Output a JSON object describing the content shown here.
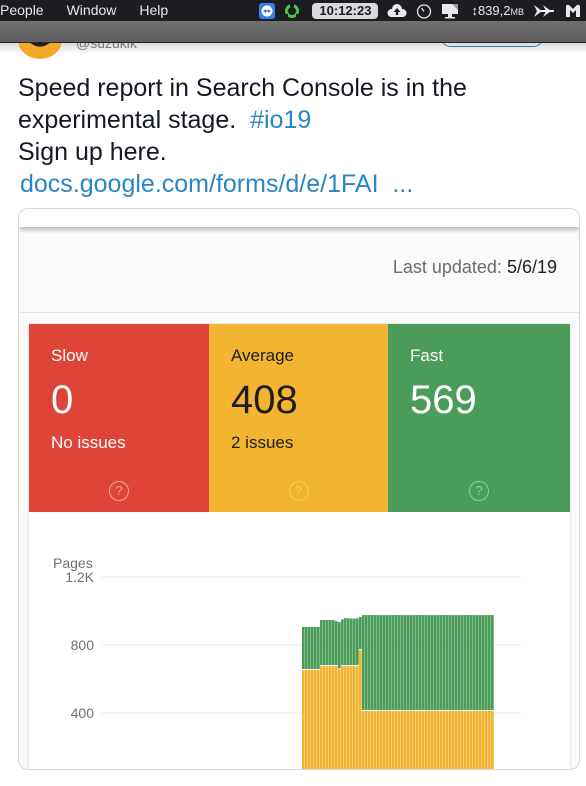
{
  "menubar": {
    "menus": [
      "People",
      "Window",
      "Help"
    ],
    "icons": [
      "teamviewer-icon",
      "sync-icon",
      "upload-cloud-icon",
      "timer-icon",
      "display-icon",
      "forward-icon",
      "malwarebytes-icon"
    ],
    "clock": "10:12:23",
    "memory": "839,2",
    "memory_unit": "MB"
  },
  "tweet": {
    "handle": "@suzukik",
    "text_line1": "Speed report in Search Console is in the",
    "text_line2": "experimental stage.",
    "hashtag": "#io19",
    "text_line3": "Sign up here.",
    "link": "docs.google.com/forms/d/e/1FAI",
    "link_ellipsis": "..."
  },
  "card": {
    "last_updated_label": "Last updated:",
    "last_updated_value": "5/6/19",
    "tiles": [
      {
        "label": "Slow",
        "value": "0",
        "sub": "No issues",
        "color": "#de4437"
      },
      {
        "label": "Average",
        "value": "408",
        "sub": "2 issues",
        "color": "#f3b432"
      },
      {
        "label": "Fast",
        "value": "569",
        "sub": "",
        "color": "#4b9c59"
      }
    ]
  },
  "chart_data": {
    "type": "bar",
    "stacked": true,
    "ylabel": "Pages",
    "yticks": [
      "1.2K",
      "800",
      "400"
    ],
    "ylim": [
      0,
      1200
    ],
    "grid": true,
    "series_colors": {
      "Average": "#f3b432",
      "Fast": "#4b9c59"
    },
    "note": "Leading portion of the x-range has no data; bars occupy the right part of the plot. Chart cropped at bottom.",
    "empty_leading_fraction": 0.5,
    "series": [
      {
        "name": "Average",
        "values": [
          653,
          653,
          653,
          653,
          653,
          653,
          676,
          676,
          676,
          676,
          676,
          676,
          656,
          676,
          676,
          676,
          676,
          676,
          676,
          770,
          412,
          412,
          412,
          412,
          412,
          412,
          412,
          412,
          412,
          412,
          412,
          412,
          412,
          412,
          412,
          412,
          412,
          412,
          412,
          412,
          412,
          412,
          412,
          412,
          412,
          412,
          412,
          412,
          412,
          412,
          412,
          412,
          412,
          412,
          412,
          412,
          412,
          412,
          412,
          412,
          412,
          412,
          412,
          412
        ]
      },
      {
        "name": "Fast",
        "values": [
          253,
          253,
          253,
          253,
          253,
          253,
          271,
          271,
          271,
          271,
          271,
          265,
          279,
          275,
          282,
          282,
          280,
          279,
          282,
          195,
          564,
          564,
          564,
          564,
          564,
          564,
          564,
          564,
          564,
          564,
          564,
          564,
          564,
          564,
          564,
          564,
          564,
          564,
          564,
          564,
          564,
          564,
          564,
          564,
          564,
          564,
          564,
          564,
          564,
          564,
          564,
          564,
          564,
          564,
          564,
          564,
          564,
          564,
          564,
          564,
          564,
          564,
          564,
          564
        ]
      }
    ]
  }
}
